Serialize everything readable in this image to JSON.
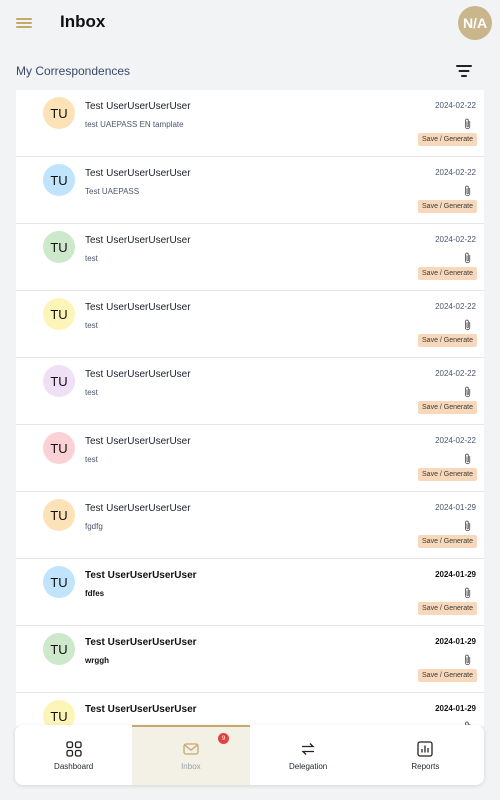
{
  "header": {
    "title": "Inbox",
    "user_initials": "N/A"
  },
  "section": {
    "label": "My Correspondences"
  },
  "items": [
    {
      "initials": "TU",
      "name": "Test UserUserUserUser",
      "subject": "test UAEPASS EN tamplate",
      "date": "2024-02-22",
      "action": "Save / Generate",
      "color": "#fde2b8",
      "unread": false
    },
    {
      "initials": "TU",
      "name": "Test UserUserUserUser",
      "subject": "Test UAEPASS",
      "date": "2024-02-22",
      "action": "Save / Generate",
      "color": "#bfe4fb",
      "unread": false
    },
    {
      "initials": "TU",
      "name": "Test UserUserUserUser",
      "subject": "test",
      "date": "2024-02-22",
      "action": "Save / Generate",
      "color": "#cde8cb",
      "unread": false
    },
    {
      "initials": "TU",
      "name": "Test UserUserUserUser",
      "subject": "test",
      "date": "2024-02-22",
      "action": "Save / Generate",
      "color": "#fdf5b8",
      "unread": false
    },
    {
      "initials": "TU",
      "name": "Test UserUserUserUser",
      "subject": "test",
      "date": "2024-02-22",
      "action": "Save / Generate",
      "color": "#f0e0f5",
      "unread": false
    },
    {
      "initials": "TU",
      "name": "Test UserUserUserUser",
      "subject": "test",
      "date": "2024-02-22",
      "action": "Save / Generate",
      "color": "#fbd1d5",
      "unread": false
    },
    {
      "initials": "TU",
      "name": "Test UserUserUserUser",
      "subject": "fgdfg",
      "date": "2024-01-29",
      "action": "Save / Generate",
      "color": "#fde2b8",
      "unread": false
    },
    {
      "initials": "TU",
      "name": "Test UserUserUserUser",
      "subject": "fdfes",
      "date": "2024-01-29",
      "action": "Save / Generate",
      "color": "#bfe4fb",
      "unread": true
    },
    {
      "initials": "TU",
      "name": "Test UserUserUserUser",
      "subject": "wrggh",
      "date": "2024-01-29",
      "action": "Save / Generate",
      "color": "#cde8cb",
      "unread": true
    },
    {
      "initials": "TU",
      "name": "Test UserUserUserUser",
      "subject": "",
      "date": "2024-01-29",
      "action": "",
      "color": "#fdf5b8",
      "unread": true
    }
  ],
  "nav": [
    {
      "label": "Dashboard",
      "icon": "dashboard-icon",
      "active": false
    },
    {
      "label": "Inbox",
      "icon": "mail-icon",
      "active": true,
      "badge": "9"
    },
    {
      "label": "Delegation",
      "icon": "transfer-icon",
      "active": false
    },
    {
      "label": "Reports",
      "icon": "bar-chart-icon",
      "active": false
    }
  ],
  "colors": {
    "accent": "#c4a96a",
    "action_bg": "#f7d8ba",
    "badge": "#e2433c"
  }
}
